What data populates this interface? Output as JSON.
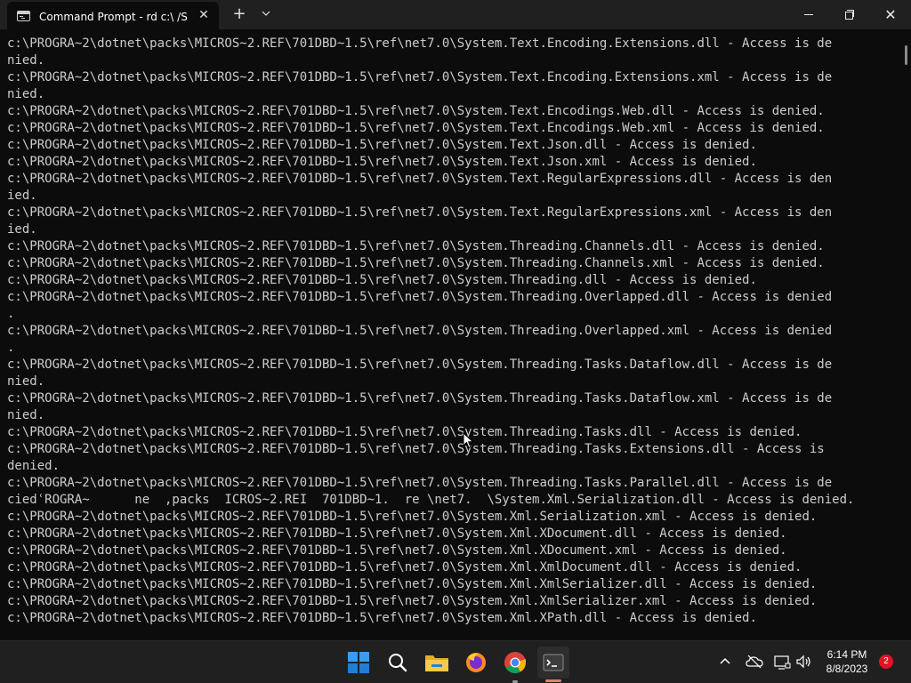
{
  "window": {
    "tab_title": "Command Prompt - rd  c:\\ /S",
    "tab_close": "✕",
    "new_tab": "+",
    "dropdown": "⌄",
    "close_glyph": "✕"
  },
  "console": {
    "lines": [
      "c:\\PROGRA~2\\dotnet\\packs\\MICROS~2.REF\\701DBD~1.5\\ref\\net7.0\\System.Text.Encoding.Extensions.dll - Access is de",
      "nied.",
      "c:\\PROGRA~2\\dotnet\\packs\\MICROS~2.REF\\701DBD~1.5\\ref\\net7.0\\System.Text.Encoding.Extensions.xml - Access is de",
      "nied.",
      "c:\\PROGRA~2\\dotnet\\packs\\MICROS~2.REF\\701DBD~1.5\\ref\\net7.0\\System.Text.Encodings.Web.dll - Access is denied.",
      "c:\\PROGRA~2\\dotnet\\packs\\MICROS~2.REF\\701DBD~1.5\\ref\\net7.0\\System.Text.Encodings.Web.xml - Access is denied.",
      "c:\\PROGRA~2\\dotnet\\packs\\MICROS~2.REF\\701DBD~1.5\\ref\\net7.0\\System.Text.Json.dll - Access is denied.",
      "c:\\PROGRA~2\\dotnet\\packs\\MICROS~2.REF\\701DBD~1.5\\ref\\net7.0\\System.Text.Json.xml - Access is denied.",
      "c:\\PROGRA~2\\dotnet\\packs\\MICROS~2.REF\\701DBD~1.5\\ref\\net7.0\\System.Text.RegularExpressions.dll - Access is den",
      "ied.",
      "c:\\PROGRA~2\\dotnet\\packs\\MICROS~2.REF\\701DBD~1.5\\ref\\net7.0\\System.Text.RegularExpressions.xml - Access is den",
      "ied.",
      "c:\\PROGRA~2\\dotnet\\packs\\MICROS~2.REF\\701DBD~1.5\\ref\\net7.0\\System.Threading.Channels.dll - Access is denied.",
      "c:\\PROGRA~2\\dotnet\\packs\\MICROS~2.REF\\701DBD~1.5\\ref\\net7.0\\System.Threading.Channels.xml - Access is denied.",
      "c:\\PROGRA~2\\dotnet\\packs\\MICROS~2.REF\\701DBD~1.5\\ref\\net7.0\\System.Threading.dll - Access is denied.",
      "c:\\PROGRA~2\\dotnet\\packs\\MICROS~2.REF\\701DBD~1.5\\ref\\net7.0\\System.Threading.Overlapped.dll - Access is denied",
      ".",
      "c:\\PROGRA~2\\dotnet\\packs\\MICROS~2.REF\\701DBD~1.5\\ref\\net7.0\\System.Threading.Overlapped.xml - Access is denied",
      ".",
      "c:\\PROGRA~2\\dotnet\\packs\\MICROS~2.REF\\701DBD~1.5\\ref\\net7.0\\System.Threading.Tasks.Dataflow.dll - Access is de",
      "nied.",
      "c:\\PROGRA~2\\dotnet\\packs\\MICROS~2.REF\\701DBD~1.5\\ref\\net7.0\\System.Threading.Tasks.Dataflow.xml - Access is de",
      "nied.",
      "c:\\PROGRA~2\\dotnet\\packs\\MICROS~2.REF\\701DBD~1.5\\ref\\net7.0\\System.Threading.Tasks.dll - Access is denied.",
      "c:\\PROGRA~2\\dotnet\\packs\\MICROS~2.REF\\701DBD~1.5\\ref\\net7.0\\System.Threading.Tasks.Extensions.dll - Access is",
      "denied.",
      "c:\\PROGRA~2\\dotnet\\packs\\MICROS~2.REF\\701DBD~1.5\\ref\\net7.0\\System.Threading.Tasks.Parallel.dll - Access is de",
      "ciedʿROGRA~      ne  ,packs  ICROS~2.REI  701DBD~1.  re \\net7.  \\System.Xml.Serialization.dll - Access is denied.",
      "c:\\PROGRA~2\\dotnet\\packs\\MICROS~2.REF\\701DBD~1.5\\ref\\net7.0\\System.Xml.Serialization.xml - Access is denied.",
      "c:\\PROGRA~2\\dotnet\\packs\\MICROS~2.REF\\701DBD~1.5\\ref\\net7.0\\System.Xml.XDocument.dll - Access is denied.",
      "c:\\PROGRA~2\\dotnet\\packs\\MICROS~2.REF\\701DBD~1.5\\ref\\net7.0\\System.Xml.XDocument.xml - Access is denied.",
      "c:\\PROGRA~2\\dotnet\\packs\\MICROS~2.REF\\701DBD~1.5\\ref\\net7.0\\System.Xml.XmlDocument.dll - Access is denied.",
      "c:\\PROGRA~2\\dotnet\\packs\\MICROS~2.REF\\701DBD~1.5\\ref\\net7.0\\System.Xml.XmlSerializer.dll - Access is denied.",
      "c:\\PROGRA~2\\dotnet\\packs\\MICROS~2.REF\\701DBD~1.5\\ref\\net7.0\\System.Xml.XmlSerializer.xml - Access is denied.",
      "c:\\PROGRA~2\\dotnet\\packs\\MICROS~2.REF\\701DBD~1.5\\ref\\net7.0\\System.Xml.XPath.dll - Access is denied."
    ]
  },
  "taskbar": {
    "apps": [
      {
        "icon": "windows-start-icon"
      },
      {
        "icon": "search-icon"
      },
      {
        "icon": "file-explorer-icon"
      },
      {
        "icon": "firefox-icon"
      },
      {
        "icon": "chrome-icon"
      },
      {
        "icon": "terminal-icon"
      }
    ],
    "time": "6:14 PM",
    "date": "8/8/2023",
    "notification_count": "2"
  },
  "colors": {
    "console_background": "#0c0c0c",
    "console_text": "#cccccc",
    "titlebar": "#202020",
    "active_app_indicator": "#e2816a",
    "notification_badge": "#e81123"
  }
}
